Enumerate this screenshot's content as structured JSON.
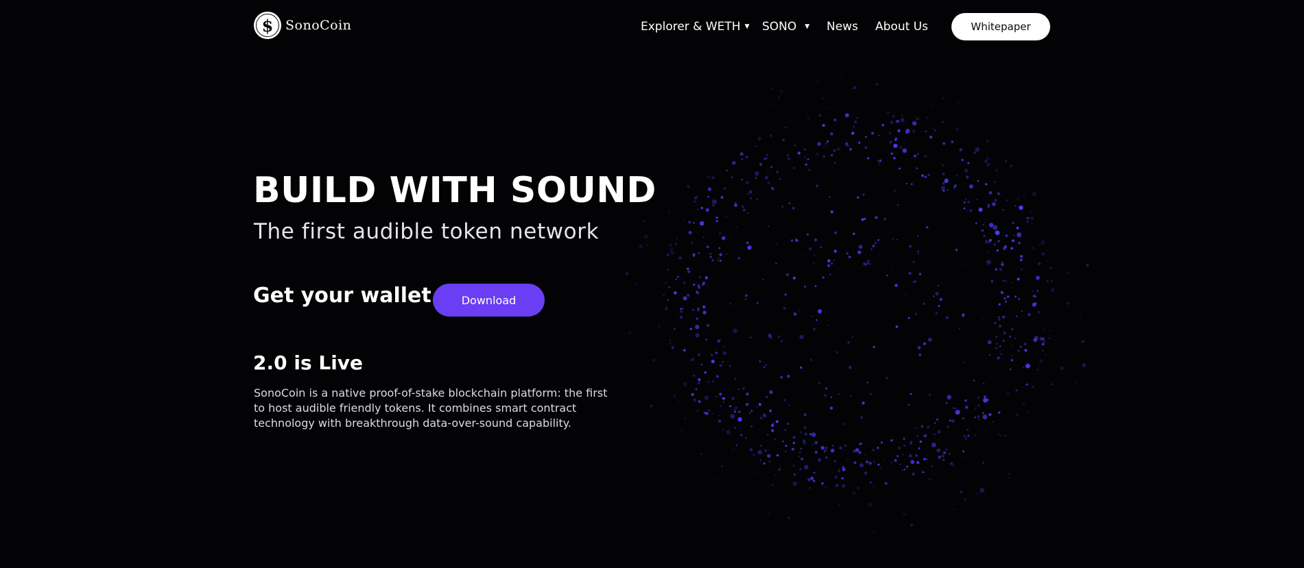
{
  "header": {
    "logo_text": "SonoCoin",
    "logo_glyph": "$",
    "nav": [
      {
        "label": "Explorer & WETH",
        "has_dropdown": true
      },
      {
        "label": "SONO",
        "has_dropdown": true
      },
      {
        "label": "News",
        "has_dropdown": false
      },
      {
        "label": "About Us",
        "has_dropdown": false
      }
    ],
    "whitepaper_label": "Whitepaper"
  },
  "hero": {
    "title": "BUILD WITH SOUND",
    "subtitle": "The first audible token network",
    "wallet_label": "Get your wallet",
    "download_label": "Download",
    "live_heading": "2.0 is Live",
    "description": "SonoCoin is a native proof-of-stake blockchain platform: the first to host audible friendly tokens. It combines smart contract technology with breakthrough data-over-sound capability."
  },
  "colors": {
    "background": "#030305",
    "accent": "#6a3ef3",
    "particle": "#4a3cf0",
    "text": "#ffffff"
  },
  "icons": {
    "logo": "sonocoin-logo-icon",
    "dropdown": "caret-down-icon"
  }
}
